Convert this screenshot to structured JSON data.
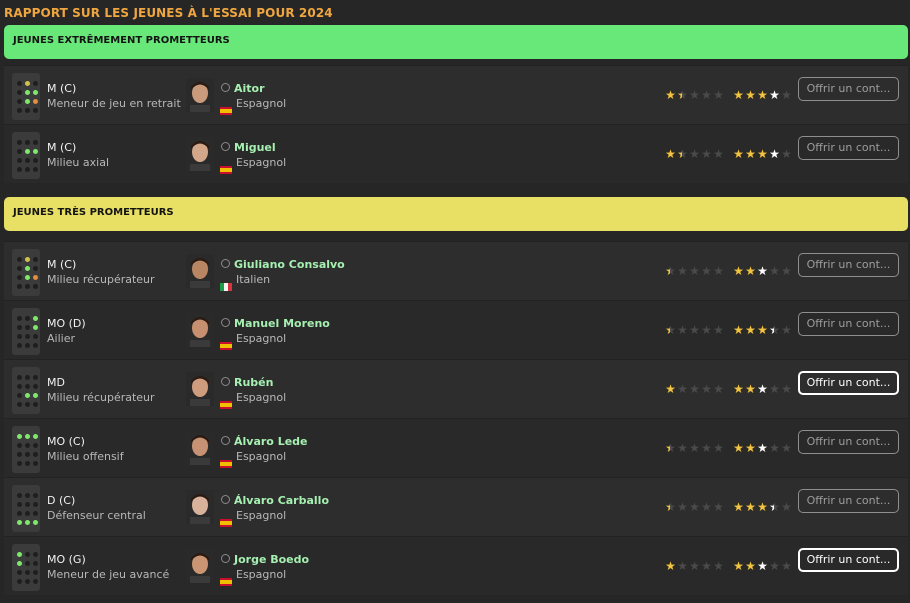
{
  "report_title": "RAPPORT SUR LES JEUNES À L'ESSAI POUR 2024",
  "sections": [
    {
      "title": "JEUNES EXTRÊMEMENT PROMETTEURS",
      "rows": [
        {
          "pos": "M (C)",
          "role": "Meneur de jeu en retrait",
          "name": "Aitor",
          "nation": "Espagnol",
          "flag": "es",
          "ca": 1.5,
          "pa": 4.0,
          "offer": "Offrir un cont...",
          "active": false
        },
        {
          "pos": "M (C)",
          "role": "Milieu axial",
          "name": "Miguel",
          "nation": "Espagnol",
          "flag": "es",
          "ca": 1.5,
          "pa": 4.0,
          "offer": "Offrir un cont...",
          "active": false
        }
      ]
    },
    {
      "title": "JEUNES TRÈS PROMETTEURS",
      "rows": [
        {
          "pos": "M (C)",
          "role": "Milieu récupérateur",
          "name": "Giuliano Consalvo",
          "nation": "Italien",
          "flag": "it",
          "ca": 0.5,
          "pa": 3.0,
          "offer": "Offrir un cont...",
          "active": false
        },
        {
          "pos": "MO (D)",
          "role": "Ailier",
          "name": "Manuel Moreno",
          "nation": "Espagnol",
          "flag": "es",
          "ca": 0.5,
          "pa": 3.5,
          "offer": "Offrir un cont...",
          "active": false
        },
        {
          "pos": "MD",
          "role": "Milieu récupérateur",
          "name": "Rubén",
          "nation": "Espagnol",
          "flag": "es",
          "ca": 1.0,
          "pa": 3.0,
          "offer": "Offrir un cont...",
          "active": true
        },
        {
          "pos": "MO (C)",
          "role": "Milieu offensif",
          "name": "Álvaro Lede",
          "nation": "Espagnol",
          "flag": "es",
          "ca": 0.5,
          "pa": 3.0,
          "offer": "Offrir un cont...",
          "active": false
        },
        {
          "pos": "D (C)",
          "role": "Défenseur central",
          "name": "Álvaro Carballo",
          "nation": "Espagnol",
          "flag": "es",
          "ca": 0.5,
          "pa": 3.5,
          "offer": "Offrir un cont...",
          "active": false
        },
        {
          "pos": "MO (G)",
          "role": "Meneur de jeu avancé",
          "name": "Jorge Boedo",
          "nation": "Espagnol",
          "flag": "es",
          "ca": 1.0,
          "pa": 3.0,
          "offer": "Offrir un cont...",
          "active": true
        }
      ]
    }
  ],
  "colors": {
    "accent_title": "#f0a640",
    "green_header": "#69e87a",
    "yellow_header": "#e8df65",
    "star_gold": "#f3c43f",
    "name_green": "#a6f0b1"
  },
  "icons": [
    "position-pitch-icon",
    "person-icon",
    "spain-flag-icon",
    "italy-flag-icon",
    "star-icon"
  ]
}
